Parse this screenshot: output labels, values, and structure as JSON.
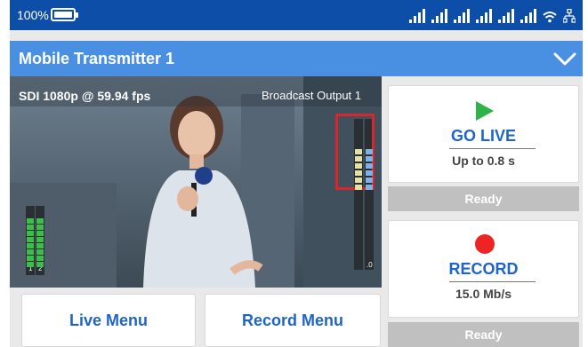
{
  "status_bar": {
    "battery_percent": "100%",
    "signal_strength": [
      4,
      4,
      4,
      4,
      4,
      4
    ],
    "icons": [
      "battery-icon",
      "signal-icon",
      "wifi-icon",
      "ethernet-icon"
    ]
  },
  "header": {
    "title": "Mobile Transmitter 1",
    "menu_icon": "chevron-down-icon"
  },
  "video": {
    "source_format": "SDI 1080p @ 59.94 fps",
    "output_name": "Broadcast Output 1",
    "audio_channels": [
      "1",
      "2"
    ],
    "meter_scale_label": ".0"
  },
  "go_live": {
    "label": "GO LIVE",
    "latency": "Up to 0.8 s",
    "status": "Ready",
    "icon": "play-icon",
    "icon_color": "#2db34a"
  },
  "record": {
    "label": "RECORD",
    "bitrate": "15.0 Mb/s",
    "status": "Ready",
    "icon": "record-icon",
    "icon_color": "#ee2323"
  },
  "menus": {
    "live_menu": "Live Menu",
    "record_menu": "Record Menu"
  },
  "colors": {
    "status_bar": "#0c4ea8",
    "title_bar": "#4a90e2",
    "accent_text": "#1f65c6",
    "ready_bg": "#c0c0c0"
  }
}
